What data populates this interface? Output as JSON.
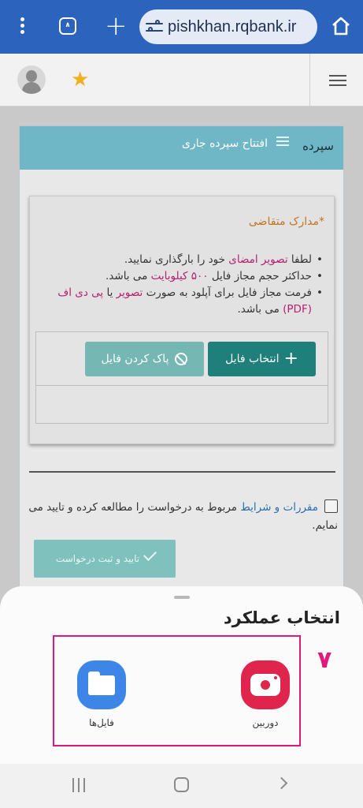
{
  "browser": {
    "url": "pishkhan.rqbank.ir",
    "tabs_count": "∧",
    "icons": [
      "more-vert-icon",
      "tabs-icon",
      "new-tab-icon",
      "site-settings-icon",
      "home-icon"
    ]
  },
  "header": {
    "icons": [
      "avatar",
      "star-icon",
      "hamburger-icon"
    ]
  },
  "panel": {
    "title": "سپرده",
    "subtitle": "افتتاح سپرده جاری",
    "docs": {
      "title": "*مدارک متقاضی",
      "items": [
        {
          "before": "لطفا ",
          "highlight": "تصویر امضای",
          "after": " خود را بارگذاری نمایید."
        },
        {
          "before": "حداکثر حجم مجاز فایل ",
          "highlight": "۵۰۰ کیلوبایت",
          "after": " می باشد."
        },
        {
          "before": "فرمت مجاز فایل برای آپلود به صورت ",
          "highlight": "تصویر",
          "middle": " یا ",
          "highlight2": "پی دی اف (PDF)",
          "after": " می باشد."
        }
      ],
      "choose_button": "انتخاب فایل",
      "clear_button": "پاک کردن فایل"
    },
    "terms": {
      "link": "مقررات و شرایط",
      "text": " مربوط به درخواست را مطالعه کرده و تایید می نمایم."
    },
    "submit_button": "تایید و ثبت درخواست"
  },
  "sheet": {
    "title": "انتخاب عملکرد",
    "apps": [
      {
        "label": "دوربین",
        "icon": "camera-icon"
      },
      {
        "label": "فایل‌ها",
        "icon": "folder-icon"
      }
    ],
    "step_number": "۷"
  },
  "colors": {
    "browser_bar": "#2b63bd",
    "panel_header": "#6fb7c6",
    "primary_button": "#1f7f7a",
    "highlight": "#b5206f",
    "annotation": "#e0197a"
  }
}
